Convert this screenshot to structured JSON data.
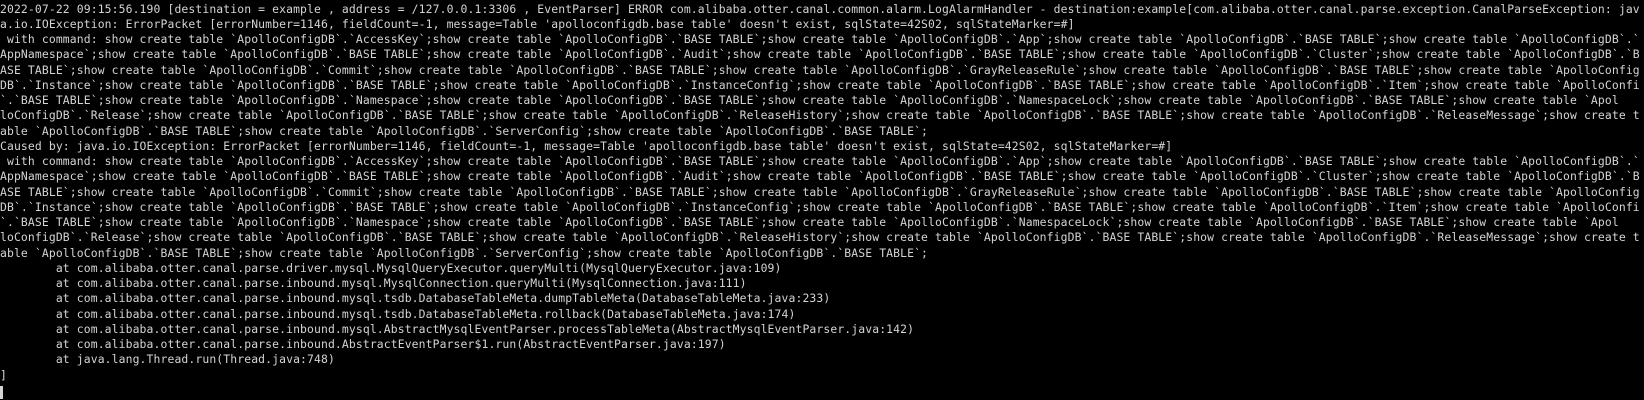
{
  "terminal": {
    "lines": [
      "2022-07-22 09:15:56.190 [destination = example , address = /127.0.0.1:3306 , EventParser] ERROR com.alibaba.otter.canal.common.alarm.LogAlarmHandler - destination:example[com.alibaba.otter.canal.parse.exception.CanalParseException: jav",
      "a.io.IOException: ErrorPacket [errorNumber=1146, fieldCount=-1, message=Table 'apolloconfigdb.base table' doesn't exist, sqlState=42S02, sqlStateMarker=#]",
      " with command: show create table `ApolloConfigDB`.`AccessKey`;show create table `ApolloConfigDB`.`BASE TABLE`;show create table `ApolloConfigDB`.`App`;show create table `ApolloConfigDB`.`BASE TABLE`;show create table `ApolloConfigDB`.`",
      "AppNamespace`;show create table `ApolloConfigDB`.`BASE TABLE`;show create table `ApolloConfigDB`.`Audit`;show create table `ApolloConfigDB`.`BASE TABLE`;show create table `ApolloConfigDB`.`Cluster`;show create table `ApolloConfigDB`.`B",
      "ASE TABLE`;show create table `ApolloConfigDB`.`Commit`;show create table `ApolloConfigDB`.`BASE TABLE`;show create table `ApolloConfigDB`.`GrayReleaseRule`;show create table `ApolloConfigDB`.`BASE TABLE`;show create table `ApolloConfig",
      "DB`.`Instance`;show create table `ApolloConfigDB`.`BASE TABLE`;show create table `ApolloConfigDB`.`InstanceConfig`;show create table `ApolloConfigDB`.`BASE TABLE`;show create table `ApolloConfigDB`.`Item`;show create table `ApolloConfi",
      "`.`BASE TABLE`;show create table `ApolloConfigDB`.`Namespace`;show create table `ApolloConfigDB`.`BASE TABLE`;show create table `ApolloConfigDB`.`NamespaceLock`;show create table `ApolloConfigDB`.`BASE TABLE`;show create table `Apol",
      "loConfigDB`.`Release`;show create table `ApolloConfigDB`.`BASE TABLE`;show create table `ApolloConfigDB`.`ReleaseHistory`;show create table `ApolloConfigDB`.`BASE TABLE`;show create table `ApolloConfigDB`.`ReleaseMessage`;show create t",
      "able `ApolloConfigDB`.`BASE TABLE`;show create table `ApolloConfigDB`.`ServerConfig`;show create table `ApolloConfigDB`.`BASE TABLE`;",
      "Caused by: java.io.IOException: ErrorPacket [errorNumber=1146, fieldCount=-1, message=Table 'apolloconfigdb.base table' doesn't exist, sqlState=42S02, sqlStateMarker=#]",
      " with command: show create table `ApolloConfigDB`.`AccessKey`;show create table `ApolloConfigDB`.`BASE TABLE`;show create table `ApolloConfigDB`.`App`;show create table `ApolloConfigDB`.`BASE TABLE`;show create table `ApolloConfigDB`.`",
      "AppNamespace`;show create table `ApolloConfigDB`.`BASE TABLE`;show create table `ApolloConfigDB`.`Audit`;show create table `ApolloConfigDB`.`BASE TABLE`;show create table `ApolloConfigDB`.`Cluster`;show create table `ApolloConfigDB`.`B",
      "ASE TABLE`;show create table `ApolloConfigDB`.`Commit`;show create table `ApolloConfigDB`.`BASE TABLE`;show create table `ApolloConfigDB`.`GrayReleaseRule`;show create table `ApolloConfigDB`.`BASE TABLE`;show create table `ApolloConfig",
      "DB`.`Instance`;show create table `ApolloConfigDB`.`BASE TABLE`;show create table `ApolloConfigDB`.`InstanceConfig`;show create table `ApolloConfigDB`.`BASE TABLE`;show create table `ApolloConfigDB`.`Item`;show create table `ApolloConfi",
      "`.`BASE TABLE`;show create table `ApolloConfigDB`.`Namespace`;show create table `ApolloConfigDB`.`BASE TABLE`;show create table `ApolloConfigDB`.`NamespaceLock`;show create table `ApolloConfigDB`.`BASE TABLE`;show create table `Apol",
      "loConfigDB`.`Release`;show create table `ApolloConfigDB`.`BASE TABLE`;show create table `ApolloConfigDB`.`ReleaseHistory`;show create table `ApolloConfigDB`.`BASE TABLE`;show create table `ApolloConfigDB`.`ReleaseMessage`;show create t",
      "able `ApolloConfigDB`.`BASE TABLE`;show create table `ApolloConfigDB`.`ServerConfig`;show create table `ApolloConfigDB`.`BASE TABLE`;",
      "        at com.alibaba.otter.canal.parse.driver.mysql.MysqlQueryExecutor.queryMulti(MysqlQueryExecutor.java:109)",
      "        at com.alibaba.otter.canal.parse.inbound.mysql.MysqlConnection.queryMulti(MysqlConnection.java:111)",
      "        at com.alibaba.otter.canal.parse.inbound.mysql.tsdb.DatabaseTableMeta.dumpTableMeta(DatabaseTableMeta.java:233)",
      "        at com.alibaba.otter.canal.parse.inbound.mysql.tsdb.DatabaseTableMeta.rollback(DatabaseTableMeta.java:174)",
      "        at com.alibaba.otter.canal.parse.inbound.mysql.AbstractMysqlEventParser.processTableMeta(AbstractMysqlEventParser.java:142)",
      "        at com.alibaba.otter.canal.parse.inbound.AbstractEventParser$1.run(AbstractEventParser.java:197)",
      "        at java.lang.Thread.run(Thread.java:748)",
      "]"
    ],
    "colors": {
      "background": "#000000",
      "text": "#d4d4d4"
    }
  }
}
